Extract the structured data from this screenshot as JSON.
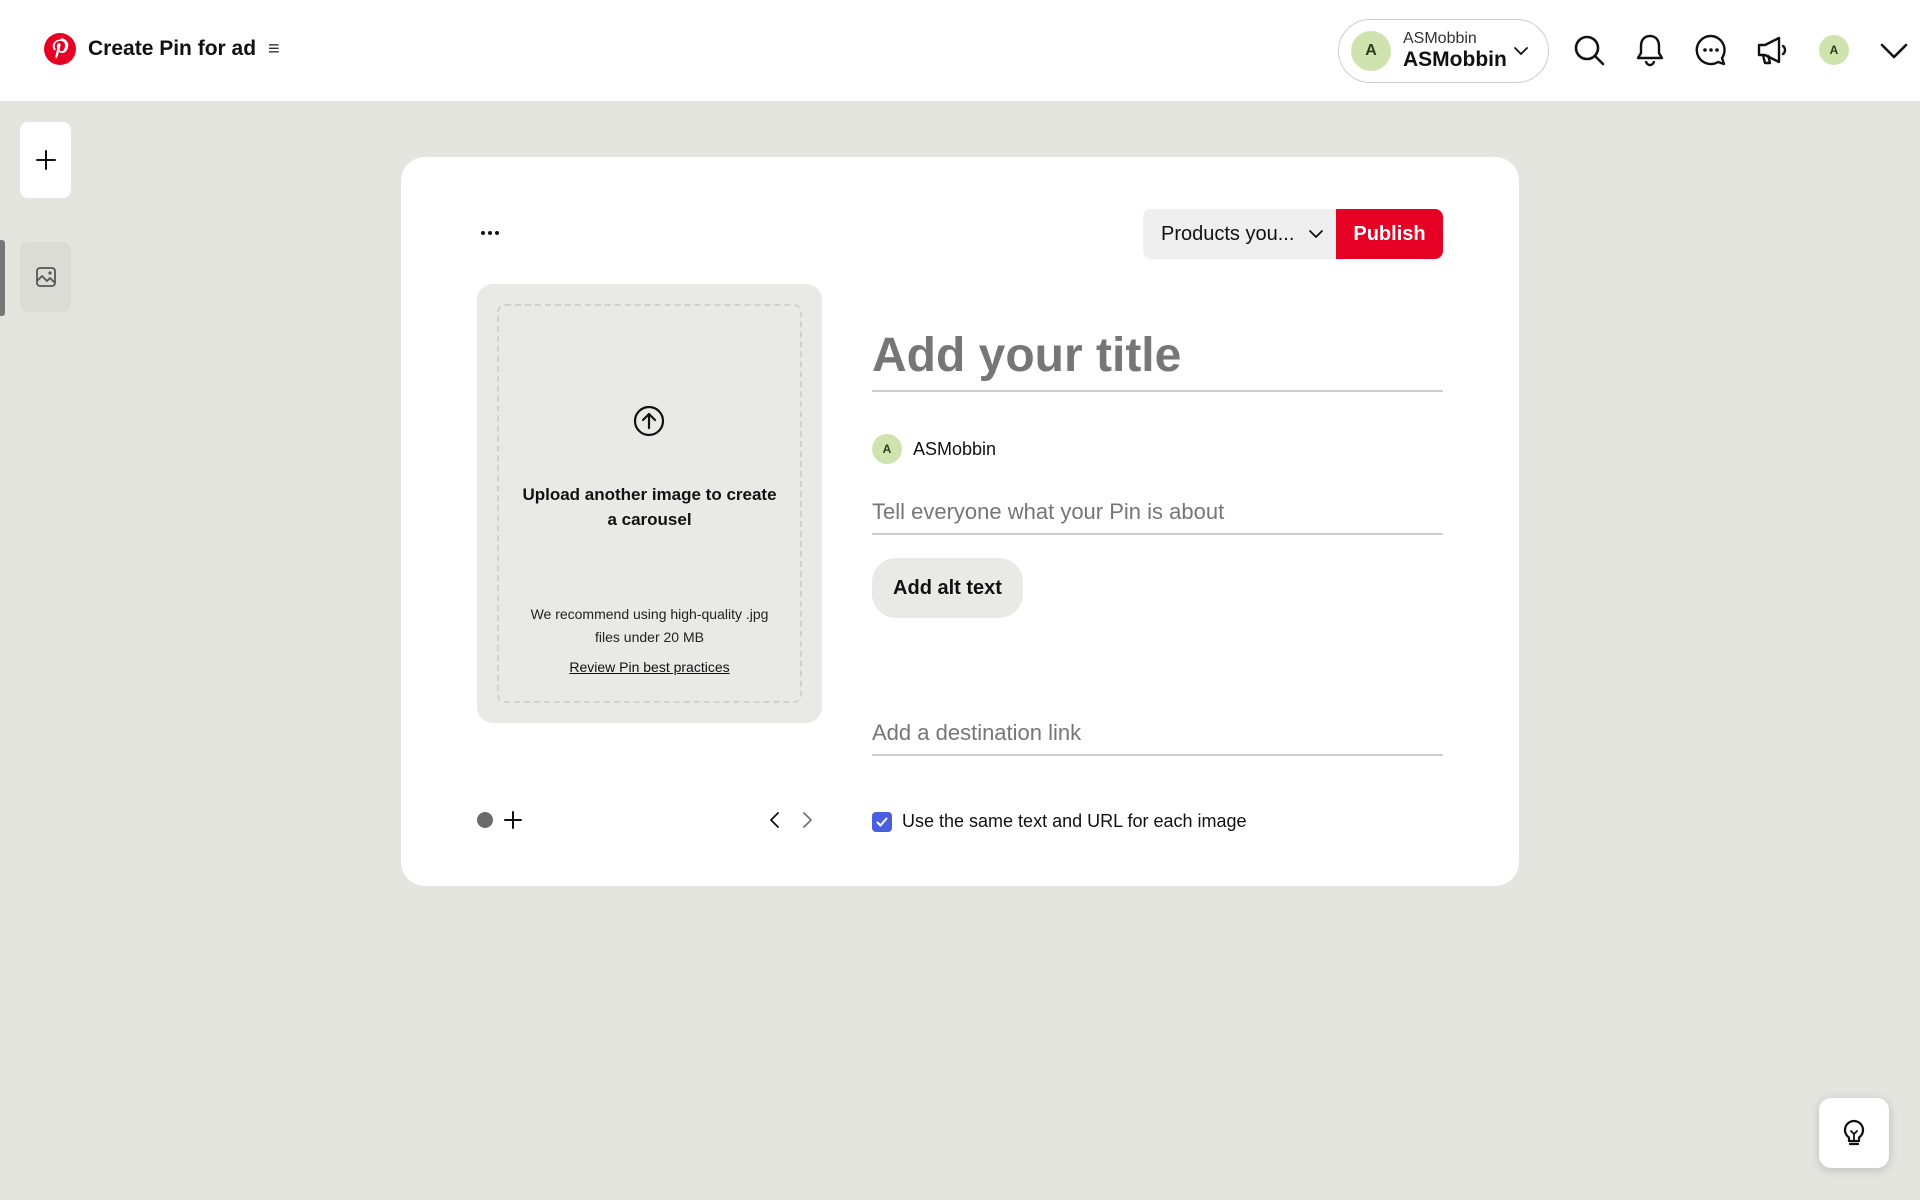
{
  "header": {
    "title": "Create Pin for ad",
    "menu_icon": "≡",
    "account": {
      "initial": "A",
      "handle_small": "ASMobbin",
      "handle_big": "ASMobbin"
    },
    "avatar_initial": "A",
    "icons": [
      "search-icon",
      "bell-icon",
      "messages-icon",
      "megaphone-icon"
    ]
  },
  "editor": {
    "board_select": "Products you...",
    "publish_label": "Publish",
    "upload": {
      "prompt": "Upload another image to create a carousel",
      "recommendation": "We recommend using high-quality .jpg files under 20 MB",
      "review_link": "Review Pin best practices"
    },
    "title_placeholder": "Add your title",
    "author_initial": "A",
    "author_name": "ASMobbin",
    "description_placeholder": "Tell everyone what your Pin is about",
    "alt_text_label": "Add alt text",
    "link_placeholder": "Add a destination link",
    "same_text_label": "Use the same text and URL for each image",
    "same_text_checked": true
  },
  "colors": {
    "brand": "#e60023",
    "checkbox": "#4a5ee0",
    "avatar_bg": "#cfe3ae"
  }
}
